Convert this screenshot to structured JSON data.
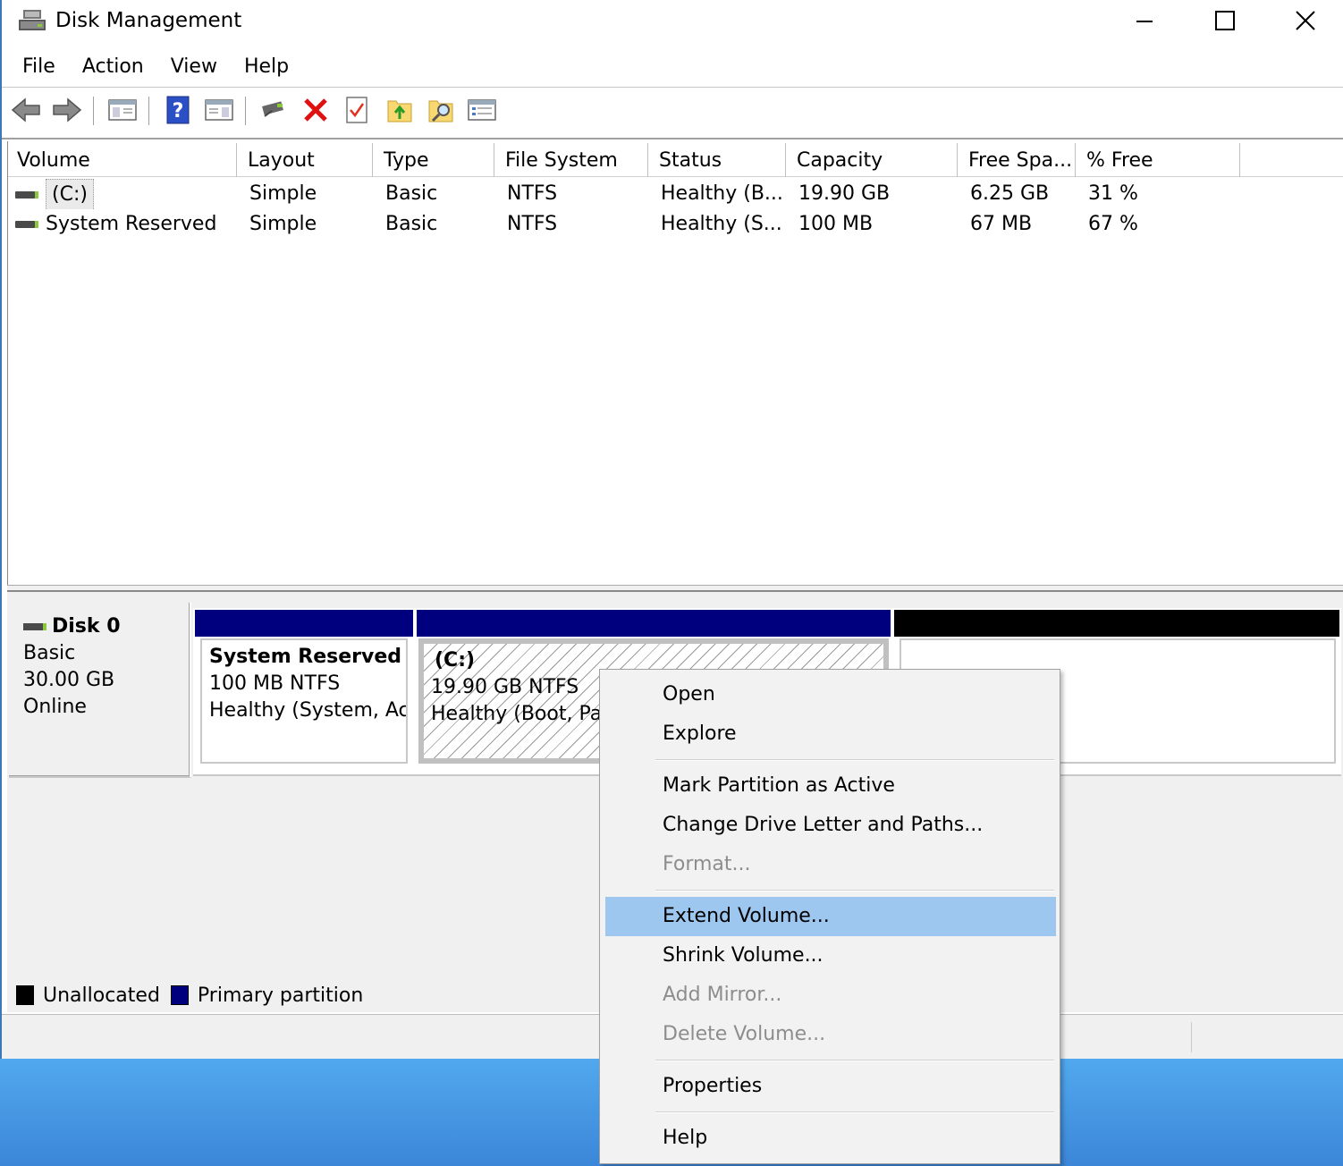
{
  "window": {
    "title": "Disk Management"
  },
  "menubar": {
    "items": [
      "File",
      "Action",
      "View",
      "Help"
    ]
  },
  "toolbar": {
    "icons": [
      "back-arrow-icon",
      "forward-arrow-icon",
      "console-tree-icon",
      "help-icon",
      "show-hide-icon",
      "connect-icon",
      "delete-icon",
      "properties-icon",
      "up-folder-icon",
      "search-folder-icon",
      "list-view-icon"
    ]
  },
  "volume_list": {
    "columns": [
      "Volume",
      "Layout",
      "Type",
      "File System",
      "Status",
      "Capacity",
      "Free Spa...",
      "% Free"
    ],
    "rows": [
      {
        "volume": "(C:)",
        "layout": "Simple",
        "type": "Basic",
        "fs": "NTFS",
        "status": "Healthy (B...",
        "capacity": "19.90 GB",
        "free": "6.25 GB",
        "pct": "31 %"
      },
      {
        "volume": "System Reserved",
        "layout": "Simple",
        "type": "Basic",
        "fs": "NTFS",
        "status": "Healthy (S...",
        "capacity": "100 MB",
        "free": "67 MB",
        "pct": "67 %"
      }
    ]
  },
  "disk": {
    "name": "Disk 0",
    "type": "Basic",
    "size": "30.00 GB",
    "state": "Online",
    "partitions": [
      {
        "title": "System Reserved",
        "size_fs": "100 MB NTFS",
        "status": "Healthy (System, Active, Primary Partition)"
      },
      {
        "title": "(C:)",
        "size_fs": "19.90 GB NTFS",
        "status": "Healthy (Boot, Page File, Crash Dump, Primary Partition)"
      }
    ]
  },
  "legend": {
    "unallocated": "Unallocated",
    "primary": "Primary partition"
  },
  "colors": {
    "primary": "#00007f",
    "unallocated": "#000000",
    "highlight": "#9ec7f0",
    "desktop": "#4a9ae6"
  },
  "context_menu": {
    "items": [
      {
        "label": "Open",
        "disabled": false
      },
      {
        "label": "Explore",
        "disabled": false
      },
      {
        "label": "Mark Partition as Active",
        "disabled": false
      },
      {
        "label": "Change Drive Letter and Paths...",
        "disabled": false
      },
      {
        "label": "Format...",
        "disabled": true
      },
      {
        "label": "Extend Volume...",
        "disabled": false,
        "highlighted": true
      },
      {
        "label": "Shrink Volume...",
        "disabled": false
      },
      {
        "label": "Add Mirror...",
        "disabled": true
      },
      {
        "label": "Delete Volume...",
        "disabled": true
      },
      {
        "label": "Properties",
        "disabled": false
      },
      {
        "label": "Help",
        "disabled": false
      }
    ]
  }
}
